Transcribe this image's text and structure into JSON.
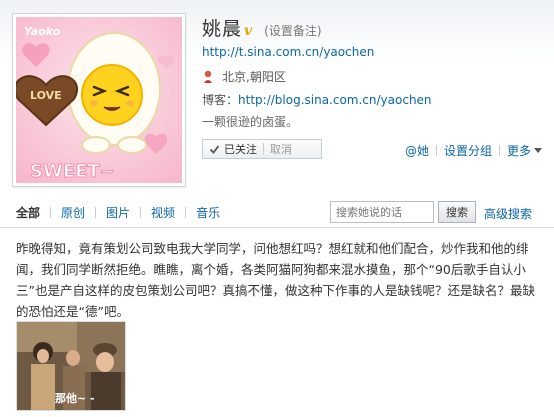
{
  "profile": {
    "name": "姚晨",
    "verified_badge": "v",
    "set_remark": "(设置备注)",
    "url": "http://t.sina.com.cn/yaochen",
    "location": "北京,朝阳区",
    "blog_label": "博客：",
    "blog_url": "http://blog.sina.com.cn/yaochen",
    "bio": "一颗很逊的卤蛋。",
    "avatar": {
      "love_text": "LOVE",
      "sweet_text": "SWEET~",
      "corner_text": "Yaoko"
    }
  },
  "follow": {
    "followed_label": "已关注",
    "unfollow_label": "取消"
  },
  "actions": {
    "at_her": "@她",
    "set_group": "设置分组",
    "more": "更多"
  },
  "tabs": [
    {
      "label": "全部",
      "active": true
    },
    {
      "label": "原创",
      "active": false
    },
    {
      "label": "图片",
      "active": false
    },
    {
      "label": "视频",
      "active": false
    },
    {
      "label": "音乐",
      "active": false
    }
  ],
  "search": {
    "placeholder": "搜索她说的话",
    "button_label": "搜索",
    "advanced_label": "高级搜索"
  },
  "post": {
    "text": "昨晚得知，竟有策划公司致电我大学同学，问他想红吗？想红就和他们配合，炒作我和他的绯闻，我们同学断然拒绝。瞧瞧，离个婚，各类阿猫阿狗都来混水摸鱼，那个“90后歌手自认小三”也是产自这样的皮包策划公司吧？真搞不懂，做这种下作事的人是缺钱呢？还是缺名？最缺的恐怕还是“德”吧。",
    "image_caption": "那他~ -"
  },
  "colors": {
    "link": "#0a66a8",
    "verified": "#e8a400",
    "text": "#333333"
  }
}
